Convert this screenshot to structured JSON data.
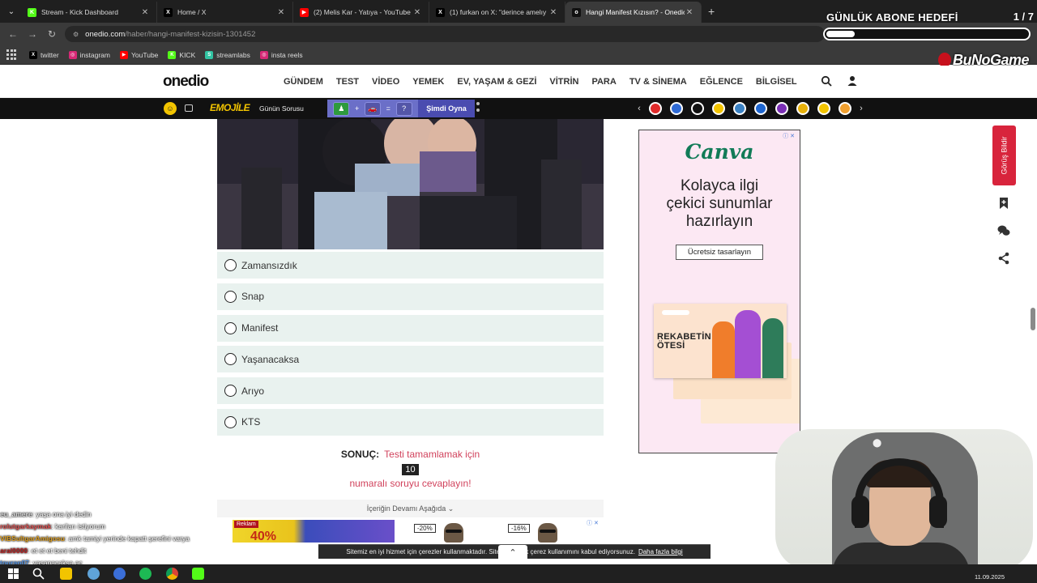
{
  "browser": {
    "tabs": [
      {
        "label": "Stream - Kick Dashboard",
        "fav_color": "#53fc18",
        "fav_text": "K",
        "active": false
      },
      {
        "label": "Home / X",
        "fav_color": "#000000",
        "fav_text": "X",
        "active": false
      },
      {
        "label": "(2) Melis Kar - Yatıya - YouTube",
        "fav_color": "#ff0000",
        "fav_text": "▶",
        "active": false
      },
      {
        "label": "(1) furkan on X: \"derince amelıy",
        "fav_color": "#000000",
        "fav_text": "X",
        "active": false
      },
      {
        "label": "Hangi Manifest Kızısın? - Onedio",
        "fav_color": "#111111",
        "fav_text": "o",
        "active": true
      }
    ],
    "new_tab": "+",
    "url_host": "onedio.com",
    "url_path": "/haber/hangi-manifest-kizisin-1301452",
    "bookmarks": [
      {
        "label": "twitter",
        "color": "#000000",
        "glyph": "X"
      },
      {
        "label": "instagram",
        "color": "#d62976",
        "glyph": "◎"
      },
      {
        "label": "YouTube",
        "color": "#ff0000",
        "glyph": "▶"
      },
      {
        "label": "KICK",
        "color": "#53fc18",
        "glyph": "K"
      },
      {
        "label": "streamlabs",
        "color": "#31c3a2",
        "glyph": "S"
      },
      {
        "label": "insta reels",
        "color": "#d62976",
        "glyph": "◎"
      }
    ]
  },
  "overlay": {
    "goal_title": "GÜNLÜK ABONE HEDEFİ",
    "goal_count": "1 / 7",
    "goal_progress": 0.14,
    "brand": "BuNoGame"
  },
  "site": {
    "logo": "onedio",
    "nav": [
      "GÜNDEM",
      "TEST",
      "VİDEO",
      "YEMEK",
      "EV, YAŞAM & GEZİ",
      "VİTRİN",
      "PARA",
      "TV & SİNEMA",
      "EĞLENCE",
      "BİLGİSEL"
    ],
    "emoji_brand": "EMOJİLE",
    "emoji_question": "Günün Sorusu",
    "emoji_question_mark": "?",
    "emoji_plus": "+",
    "emoji_equals": "=",
    "emoji_play": "Şimdi Oyna",
    "category_colors": [
      "#e02b2b",
      "#2f6bd6",
      "#111111",
      "#f2c400",
      "#3b82c4",
      "#1e66d0",
      "#7b2fb5",
      "#e7b10a",
      "#f2c400",
      "#f0a030"
    ]
  },
  "quiz": {
    "options": [
      "Zamansızdık",
      "Snap",
      "Manifest",
      "Yaşanacaksa",
      "Arıyo",
      "KTS"
    ],
    "result_label": "SONUÇ:",
    "result_text_1": "Testi tamamlamak için",
    "result_number": "10",
    "result_text_2": "numaralı soruyu cevaplayın!",
    "continue": "İçeriğin Devamı Aşağıda ⌄"
  },
  "ads": {
    "tag": "Reklam",
    "percent": "40%",
    "discount_1": "-20%",
    "discount_2": "-16%",
    "canva_logo": "Canva",
    "canva_pitch_1": "Kolayca ilgi",
    "canva_pitch_2": "çekici sunumlar",
    "canva_pitch_3": "hazırlayın",
    "canva_cta": "Ücretsiz tasarlayın",
    "canva_card_title_1": "REKABETİN",
    "canva_card_title_2": "ÖTESİ",
    "ad_info": "ⓘ ✕"
  },
  "sidebar": {
    "report": "Görüş Bildir"
  },
  "chat": [
    {
      "user": "eu_amere",
      "color": "#dddddd",
      "msg": ": yaşa ona iyi dedin"
    },
    {
      "user": "rolutgarkaymak",
      "color": "#e05050",
      "msg": ": kariları istiyorum"
    },
    {
      "user": "VIBSultgarAmigosu",
      "color": "#e0a020",
      "msg": ": amk tamiyi yerinde kapatt şerefini varya"
    },
    {
      "user": "aral0000",
      "color": "#c02020",
      "msg": ": et et et beni tehdit"
    },
    {
      "user": "touran07",
      "color": "#5090e0",
      "msg": ": yaşanacaksa aç"
    }
  ],
  "cookie": {
    "text": "Sitemiz en iyi hizmet için çerezler kullanmaktadır. Siteye girerek çerez kullanımını kabul ediyorsunuz.",
    "link": "Daha fazla bilgi"
  },
  "taskbar": {
    "date": "11.09.2025"
  }
}
